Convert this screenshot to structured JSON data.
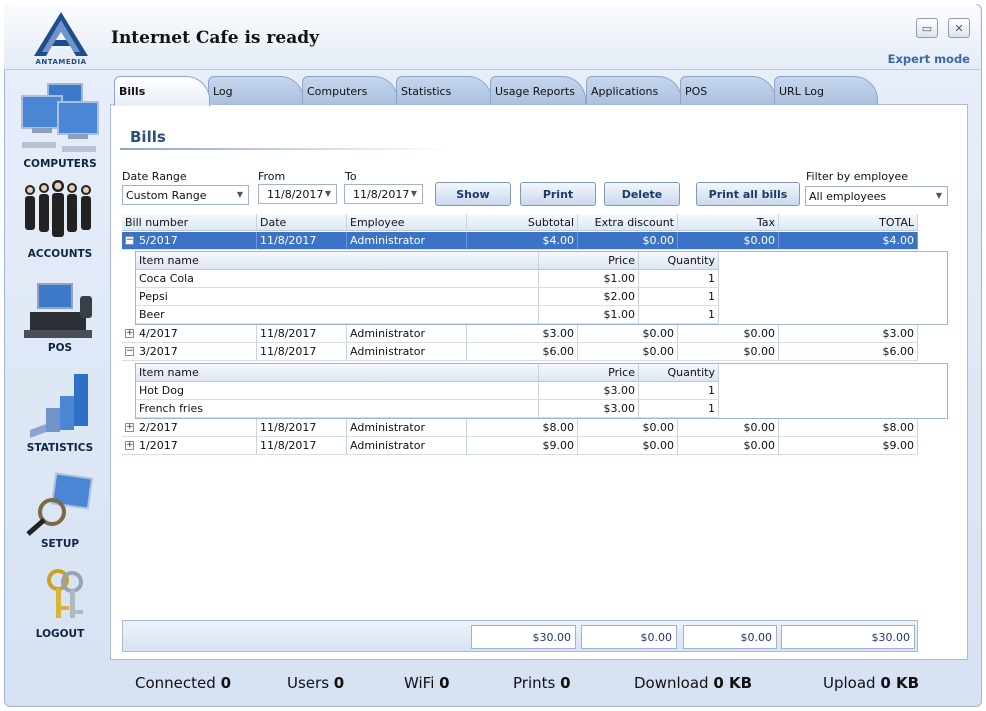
{
  "window": {
    "title": "Internet Cafe is ready",
    "logo_text": "ANTAMEDIA",
    "expert_mode": "Expert mode",
    "minimize": "▭",
    "close": "✕"
  },
  "sidebar": {
    "items": [
      {
        "label": "COMPUTERS",
        "icon": "computers-icon"
      },
      {
        "label": "ACCOUNTS",
        "icon": "accounts-icon"
      },
      {
        "label": "POS",
        "icon": "pos-icon"
      },
      {
        "label": "STATISTICS",
        "icon": "statistics-icon"
      },
      {
        "label": "SETUP",
        "icon": "setup-icon"
      },
      {
        "label": "LOGOUT",
        "icon": "logout-icon"
      }
    ]
  },
  "tabs": [
    "Bills",
    "Log",
    "Computers",
    "Statistics",
    "Usage Reports",
    "Applications",
    "POS",
    "URL Log"
  ],
  "page": {
    "heading": "Bills"
  },
  "filters": {
    "date_range_label": "Date Range",
    "date_range_value": "Custom Range",
    "from_label": "From",
    "from_value": "11/8/2017",
    "to_label": "To",
    "to_value": "11/8/2017",
    "employee_label": "Filter by employee",
    "employee_value": "All employees"
  },
  "buttons": {
    "show": "Show",
    "print": "Print",
    "delete": "Delete",
    "print_all": "Print all bills"
  },
  "grid": {
    "columns": [
      "Bill number",
      "Date",
      "Employee",
      "Subtotal",
      "Extra discount",
      "Tax",
      "TOTAL"
    ],
    "sub_columns": [
      "Item name",
      "Price",
      "Quantity"
    ],
    "bills": [
      {
        "number": "5/2017",
        "date": "11/8/2017",
        "employee": "Administrator",
        "subtotal": "$4.00",
        "discount": "$0.00",
        "tax": "$0.00",
        "total": "$4.00",
        "expanded": "−",
        "items": [
          {
            "name": "Coca Cola",
            "price": "$1.00",
            "qty": "1"
          },
          {
            "name": "Pepsi",
            "price": "$2.00",
            "qty": "1"
          },
          {
            "name": "Beer",
            "price": "$1.00",
            "qty": "1"
          }
        ]
      },
      {
        "number": "4/2017",
        "date": "11/8/2017",
        "employee": "Administrator",
        "subtotal": "$3.00",
        "discount": "$0.00",
        "tax": "$0.00",
        "total": "$3.00",
        "expanded": "+"
      },
      {
        "number": "3/2017",
        "date": "11/8/2017",
        "employee": "Administrator",
        "subtotal": "$6.00",
        "discount": "$0.00",
        "tax": "$0.00",
        "total": "$6.00",
        "expanded": "−",
        "items": [
          {
            "name": "Hot Dog",
            "price": "$3.00",
            "qty": "1"
          },
          {
            "name": "French fries",
            "price": "$3.00",
            "qty": "1"
          }
        ]
      },
      {
        "number": "2/2017",
        "date": "11/8/2017",
        "employee": "Administrator",
        "subtotal": "$8.00",
        "discount": "$0.00",
        "tax": "$0.00",
        "total": "$8.00",
        "expanded": "+"
      },
      {
        "number": "1/2017",
        "date": "11/8/2017",
        "employee": "Administrator",
        "subtotal": "$9.00",
        "discount": "$0.00",
        "tax": "$0.00",
        "total": "$9.00",
        "expanded": "+"
      }
    ],
    "totals": {
      "subtotal": "$30.00",
      "discount": "$0.00",
      "tax": "$0.00",
      "total": "$30.00"
    }
  },
  "status": {
    "connected_label": "Connected",
    "connected": "0",
    "users_label": "Users",
    "users": "0",
    "wifi_label": "WiFi",
    "wifi": "0",
    "prints_label": "Prints",
    "prints": "0",
    "download_label": "Download",
    "download": "0 KB",
    "upload_label": "Upload",
    "upload": "0 KB"
  },
  "colors": {
    "accent": "#3b73c6",
    "heading": "#2c4f7c"
  }
}
